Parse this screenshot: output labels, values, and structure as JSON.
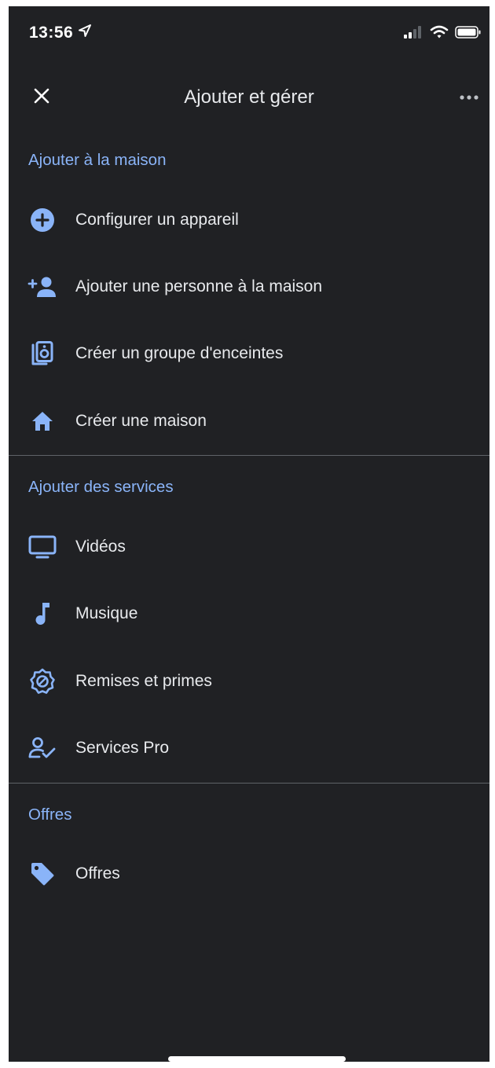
{
  "status_bar": {
    "time": "13:56"
  },
  "header": {
    "title": "Ajouter et gérer"
  },
  "colors": {
    "background": "#202124",
    "accent": "#8ab4f8",
    "text": "#e8eaed",
    "divider": "#5f6368"
  },
  "sections": [
    {
      "title": "Ajouter à la maison",
      "items": [
        {
          "label": "Configurer un appareil",
          "icon": "add-circle-icon"
        },
        {
          "label": "Ajouter une personne à la maison",
          "icon": "add-person-icon"
        },
        {
          "label": "Créer un groupe d'enceintes",
          "icon": "speaker-group-icon"
        },
        {
          "label": "Créer une maison",
          "icon": "home-icon"
        }
      ]
    },
    {
      "title": "Ajouter des services",
      "items": [
        {
          "label": "Vidéos",
          "icon": "tv-icon"
        },
        {
          "label": "Musique",
          "icon": "music-note-icon"
        },
        {
          "label": "Remises et primes",
          "icon": "discount-badge-icon"
        },
        {
          "label": "Services Pro",
          "icon": "person-check-icon"
        }
      ]
    },
    {
      "title": "Offres",
      "items": [
        {
          "label": "Offres",
          "icon": "tag-icon"
        }
      ]
    }
  ]
}
